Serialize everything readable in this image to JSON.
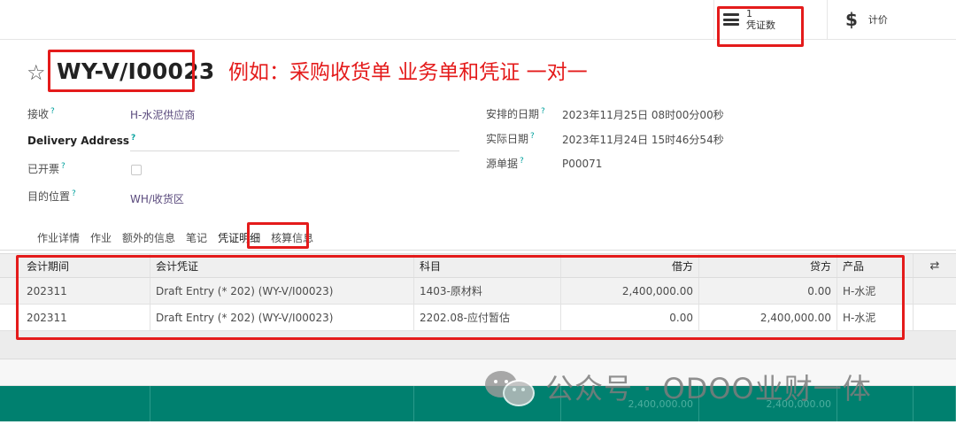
{
  "smart_buttons": {
    "vouchers": {
      "count": "1",
      "label": "凭证数",
      "icon": "list-icon"
    },
    "cost": {
      "label": "计价",
      "icon": "dollar-icon"
    }
  },
  "record": {
    "title": "WY-V/I00023",
    "annotation": "例如：采购收货单   业务单和凭证 一对一"
  },
  "fields": {
    "left": [
      {
        "label": "接收",
        "help": "?",
        "value": "H-水泥供应商"
      },
      {
        "label": "Delivery Address",
        "help": "?",
        "value": ""
      },
      {
        "label": "已开票",
        "help": "?",
        "value": ""
      },
      {
        "label": "目的位置",
        "help": "?",
        "value": "WH/收货区"
      }
    ],
    "right": [
      {
        "label": "安排的日期",
        "help": "?",
        "value": "2023年11月25日 08时00分00秒"
      },
      {
        "label": "实际日期",
        "help": "?",
        "value": "2023年11月24日 15时46分54秒"
      },
      {
        "label": "源单据",
        "help": "?",
        "value": "P00071"
      }
    ]
  },
  "tabs": [
    "作业详情",
    "作业",
    "额外的信息",
    "笔记",
    "凭证明细",
    "核算信息"
  ],
  "active_tab": "凭证明细",
  "table": {
    "columns": [
      "会计期间",
      "会计凭证",
      "科目",
      "借方",
      "贷方",
      "产品"
    ],
    "rows": [
      [
        "202311",
        "Draft Entry (* 202) (WY-V/I00023)",
        "1403-原材料",
        "2,400,000.00",
        "0.00",
        "H-水泥"
      ],
      [
        "202311",
        "Draft Entry (* 202) (WY-V/I00023)",
        "2202.08-应付暂估",
        "0.00",
        "2,400,000.00",
        "H-水泥"
      ]
    ],
    "footer": [
      "",
      "",
      "",
      "2,400,000.00",
      "2,400,000.00",
      "",
      ""
    ]
  },
  "watermark": "公众号 · ODOO业财一体",
  "colors": {
    "annotation_red": "#e41b1b",
    "link_purple": "#5a4a7d",
    "help_teal": "#00a09d",
    "footer_green": "#00806f"
  }
}
